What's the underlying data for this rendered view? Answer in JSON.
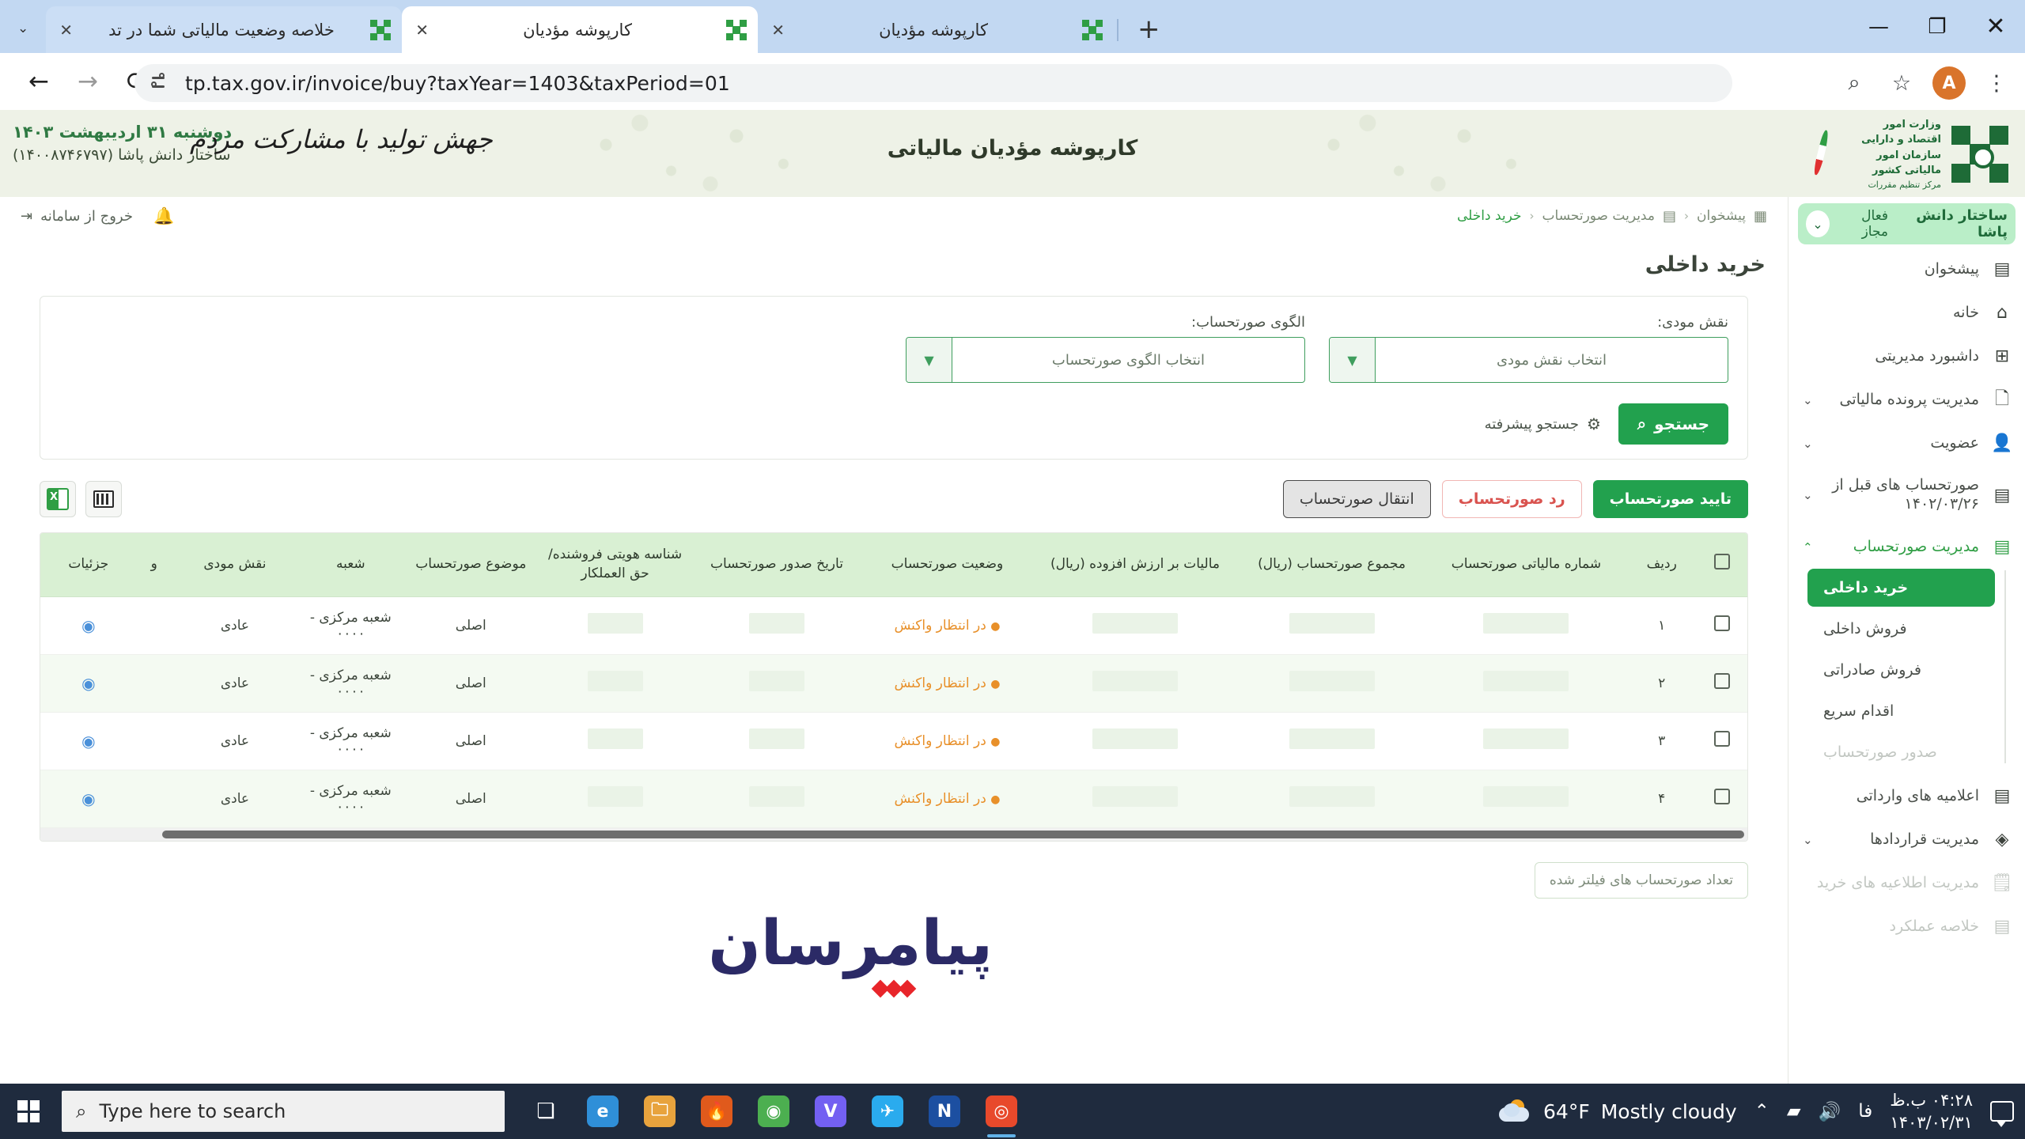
{
  "browser": {
    "tabs": [
      {
        "title": "خلاصه وضعیت مالیاتی شما در تد",
        "active": false
      },
      {
        "title": "کارپوشه مؤدیان",
        "active": true
      },
      {
        "title": "کارپوشه مؤدیان",
        "active": false
      }
    ],
    "new_tab_label": "+",
    "close_glyph": "✕",
    "tabs_dropdown_glyph": "⌄",
    "nav": {
      "back": "←",
      "forward": "→",
      "reload": "⟳"
    },
    "url": "tp.tax.gov.ir/invoice/buy?taxYear=1403&taxPeriod=01",
    "zoom_icon": "⌕",
    "bookmark_icon": "☆",
    "profile_initial": "A",
    "menu_icon": "⋮",
    "window_controls": {
      "minimize": "—",
      "maximize": "❐",
      "close": "✕"
    }
  },
  "site_header": {
    "title": "کارپوشه مؤدیان مالیاتی",
    "slogan": "جهش تولید با مشارکت مردم",
    "date_line": "دوشنبه ۳۱ اردیبهشت ۱۴۰۳",
    "user_line": "ساختار دانش پاشا (۱۴۰۰۸۷۴۶۷۹۷)",
    "org_line1": "وزارت امور اقتصاد و دارایی",
    "org_line2": "سازمان امور مالیاتی کشور",
    "org_line3": "مرکز تنظیم مقررات"
  },
  "sidebar": {
    "user": {
      "name": "ساختار دانش پاشا",
      "status": "فعال مجاز",
      "caret": "⌄"
    },
    "items": [
      {
        "label": "پیشخوان",
        "icon": "dashboard-tiles-icon",
        "glyph": "▤",
        "caret": "",
        "dim": false
      },
      {
        "label": "خانه",
        "icon": "home-icon",
        "glyph": "⌂",
        "caret": "",
        "dim": false
      },
      {
        "label": "داشبورد مدیریتی",
        "icon": "grid-icon",
        "glyph": "⊞",
        "caret": "",
        "dim": false
      },
      {
        "label": "مدیریت پرونده مالیاتی",
        "icon": "file-icon",
        "glyph": "🗋",
        "caret": "⌄",
        "dim": false
      },
      {
        "label": "عضویت",
        "icon": "user-icon",
        "glyph": "👤",
        "caret": "⌄",
        "dim": false
      },
      {
        "label": "صورتحساب های قبل از ۱۴۰۲/۰۳/۲۶",
        "icon": "invoice-icon",
        "glyph": "▤",
        "caret": "⌄",
        "dim": false
      },
      {
        "label": "مدیریت صورتحساب",
        "icon": "invoice-manage-icon",
        "glyph": "▤",
        "caret": "⌃",
        "dim": false,
        "active_parent": true
      }
    ],
    "sub_items": [
      {
        "label": "خرید داخلی",
        "selected": true,
        "dim": false
      },
      {
        "label": "فروش داخلی",
        "selected": false,
        "dim": false
      },
      {
        "label": "فروش صادراتی",
        "selected": false,
        "dim": false
      },
      {
        "label": "اقدام سریع",
        "selected": false,
        "dim": false
      },
      {
        "label": "صدور صورتحساب",
        "selected": false,
        "dim": true
      }
    ],
    "items_after": [
      {
        "label": "اعلامیه های وارداتی",
        "icon": "import-notice-icon",
        "glyph": "▤",
        "caret": "",
        "dim": false
      },
      {
        "label": "مدیریت قراردادها",
        "icon": "contract-icon",
        "glyph": "◈",
        "caret": "⌄",
        "dim": false
      },
      {
        "label": "مدیریت اطلاعیه های خرید",
        "icon": "clipboard-icon",
        "glyph": "🗒",
        "caret": "",
        "dim": true
      },
      {
        "label": "خلاصه عملکرد",
        "icon": "summary-icon",
        "glyph": "▤",
        "caret": "",
        "dim": true
      }
    ]
  },
  "topbar": {
    "breadcrumb": [
      {
        "label": "پیشخوان",
        "icon": "dashboard-icon",
        "glyph": "▦"
      },
      {
        "label": "مدیریت صورتحساب",
        "icon": "invoice-icon",
        "glyph": "▤"
      },
      {
        "label": "خرید داخلی",
        "icon": "",
        "glyph": ""
      }
    ],
    "separator": "‹",
    "exit_label": "خروج از سامانه",
    "exit_icon_glyph": "⇥",
    "bell_glyph": "🔔"
  },
  "page": {
    "title": "خرید داخلی"
  },
  "search_form": {
    "fields": [
      {
        "label": "نقش مودی:",
        "placeholder": "انتخاب نقش مودی",
        "value": "",
        "caret": "▼"
      },
      {
        "label": "الگوی صورتحساب:",
        "placeholder": "انتخاب الگوی صورتحساب",
        "value": "",
        "caret": "▼"
      }
    ],
    "search_button": "جستجو",
    "search_icon_glyph": "⌕",
    "advanced_label": "جستجو پیشرفته",
    "advanced_icon_glyph": "⚙"
  },
  "actions": {
    "confirm": "تایید صورتحساب",
    "reject": "رد صورتحساب",
    "transfer": "انتقال صورتحساب",
    "columns_icon": "columns-icon",
    "excel_icon": "excel-export-icon",
    "excel_letter": "X"
  },
  "table": {
    "headers": [
      "",
      "ردیف",
      "شماره مالیاتی صورتحساب",
      "مجموع صورتحساب (ریال)",
      "مالیات بر ارزش افزوده (ریال)",
      "وضعیت صورتحساب",
      "تاریخ صدور صورتحساب",
      "شناسه هویتی فروشنده/ حق العملکار",
      "موضوع صورتحساب",
      "شعبه",
      "نقش مودی",
      "و",
      "جزئیات"
    ],
    "rows": [
      {
        "row_no": "۱",
        "tax_number": "",
        "total": "",
        "vat": "",
        "status": "در انتظار واکنش",
        "issue_date": "",
        "seller_id": "",
        "subject": "اصلی",
        "branch": "شعبه مرکزی - ۰۰۰۰",
        "role": "عادی",
        "details_icon": "eye-icon"
      },
      {
        "row_no": "۲",
        "tax_number": "",
        "total": "",
        "vat": "",
        "status": "در انتظار واکنش",
        "issue_date": "",
        "seller_id": "",
        "subject": "اصلی",
        "branch": "شعبه مرکزی - ۰۰۰۰",
        "role": "عادی",
        "details_icon": "eye-icon"
      },
      {
        "row_no": "۳",
        "tax_number": "",
        "total": "",
        "vat": "",
        "status": "در انتظار واکنش",
        "issue_date": "",
        "seller_id": "",
        "subject": "اصلی",
        "branch": "شعبه مرکزی - ۰۰۰۰",
        "role": "عادی",
        "details_icon": "eye-icon"
      },
      {
        "row_no": "۴",
        "tax_number": "",
        "total": "",
        "vat": "",
        "status": "در انتظار واکنش",
        "issue_date": "",
        "seller_id": "",
        "subject": "اصلی",
        "branch": "شعبه مرکزی - ۰۰۰۰",
        "role": "عادی",
        "details_icon": "eye-icon"
      }
    ],
    "filter_count_label": "تعداد صورتحساب های فیلتر شده"
  },
  "footer_logo": {
    "wordmark": "پیامرسان"
  },
  "taskbar": {
    "search_placeholder": "Type here to search",
    "search_icon_glyph": "⌕",
    "task_view_glyph": "❏",
    "apps": [
      {
        "name": "edge-icon",
        "glyph": "e",
        "color": "#2f8fd8",
        "active": false
      },
      {
        "name": "file-explorer-icon",
        "glyph": "🗀",
        "color": "#e8a33d",
        "active": false
      },
      {
        "name": "flame-icon",
        "glyph": "🔥",
        "color": "#e05a1c",
        "active": false
      },
      {
        "name": "chrome-icon",
        "glyph": "◉",
        "color": "#4caf50",
        "active": false
      },
      {
        "name": "viber-icon",
        "glyph": "V",
        "color": "#7360f2",
        "active": false
      },
      {
        "name": "telegram-icon",
        "glyph": "✈",
        "color": "#2aabee",
        "active": false
      },
      {
        "name": "notion-icon",
        "glyph": "N",
        "color": "#1c4fa1",
        "active": false
      },
      {
        "name": "chrome-active-icon",
        "glyph": "◎",
        "color": "#e8492b",
        "active": true
      }
    ],
    "weather_temp": "64°F",
    "weather_desc": "Mostly cloudy",
    "chevron_glyph": "⌃",
    "wifi_glyph": "▰",
    "volume_glyph": "🔊",
    "lang": "فا",
    "time": "۰۴:۲۸ ب.ظ",
    "date": "۱۴۰۳/۰۲/۳۱",
    "notification_icon": "notification-icon"
  }
}
